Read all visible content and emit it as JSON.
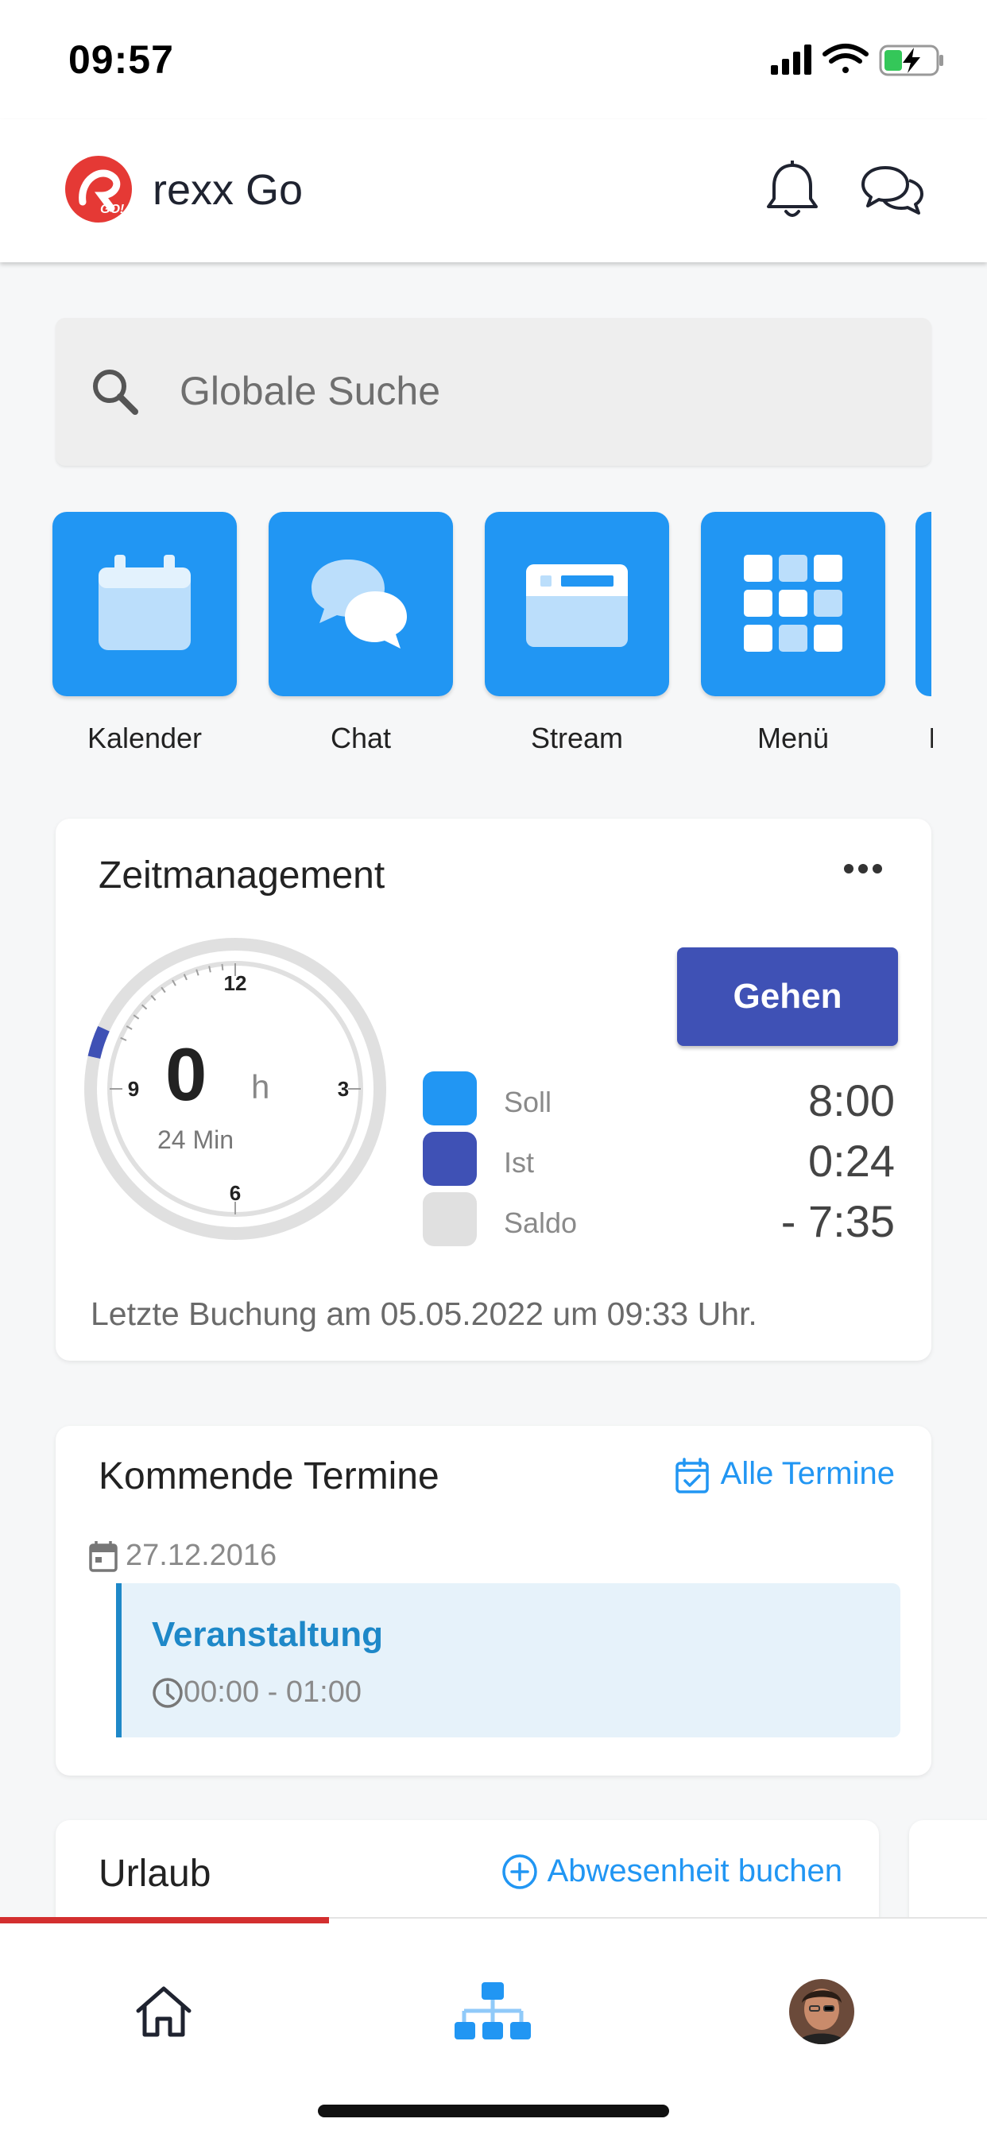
{
  "status_bar": {
    "time": "09:57"
  },
  "header": {
    "title": "rexx Go"
  },
  "search": {
    "placeholder": "Globale Suche"
  },
  "tiles": [
    {
      "label": "Kalender",
      "icon": "calendar-icon"
    },
    {
      "label": "Chat",
      "icon": "chat-bubbles-icon"
    },
    {
      "label": "Stream",
      "icon": "stream-icon"
    },
    {
      "label": "Menü",
      "icon": "grid-icon"
    },
    {
      "label": "I",
      "icon": "partial-tile"
    }
  ],
  "zeitmanagement": {
    "title": "Zeitmanagement",
    "clock_hours": "0",
    "clock_unit": "h",
    "clock_minutes": "24 Min",
    "clock_labels": {
      "top": "12",
      "right": "3",
      "bottom": "6",
      "left": "9"
    },
    "progress_fraction": 0.0333,
    "button": "Gehen",
    "legend": [
      {
        "label": "Soll",
        "value": "8:00",
        "color": "#2196f3"
      },
      {
        "label": "Ist",
        "value": "0:24",
        "color": "#3f51b5"
      },
      {
        "label": "Saldo",
        "value": "- 7:35",
        "color": "#e0e0e0"
      }
    ],
    "last_booking": "Letzte Buchung am 05.05.2022 um 09:33 Uhr."
  },
  "termine": {
    "title": "Kommende Termine",
    "link": "Alle Termine",
    "date": "27.12.2016",
    "event_title": "Veranstaltung",
    "event_time": "00:00 - 01:00"
  },
  "urlaub": {
    "title": "Urlaub",
    "link": "Abwesenheit buchen"
  },
  "colors": {
    "primary_blue": "#2196f3",
    "indigo": "#3f51b5",
    "active_nav": "#d32f2f"
  }
}
